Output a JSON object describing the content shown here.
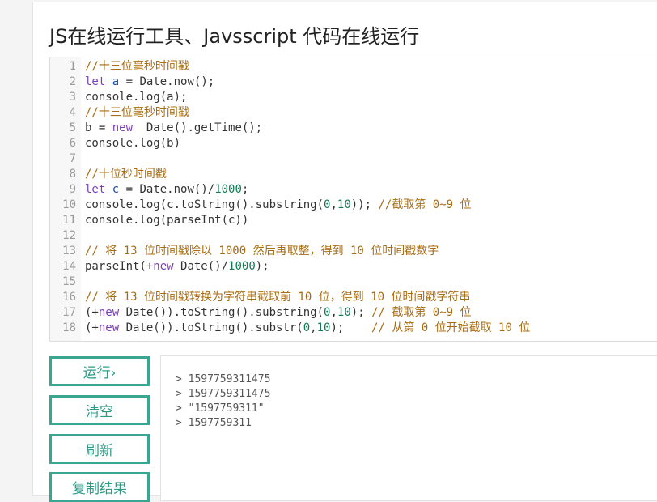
{
  "page": {
    "title": "JS在线运行工具、Javsscript 代码在线运行"
  },
  "editor": {
    "lines": [
      {
        "no": "1",
        "tokens": [
          {
            "t": "comment",
            "v": "//十三位毫秒时间戳"
          }
        ]
      },
      {
        "no": "2",
        "tokens": [
          {
            "t": "kw",
            "v": "let"
          },
          {
            "t": "plain",
            "v": " "
          },
          {
            "t": "var",
            "v": "a"
          },
          {
            "t": "plain",
            "v": " = Date.now();"
          }
        ]
      },
      {
        "no": "3",
        "tokens": [
          {
            "t": "plain",
            "v": "console.log(a);"
          }
        ]
      },
      {
        "no": "4",
        "tokens": [
          {
            "t": "comment",
            "v": "//十三位毫秒时间戳"
          }
        ]
      },
      {
        "no": "5",
        "tokens": [
          {
            "t": "plain",
            "v": "b = "
          },
          {
            "t": "kw",
            "v": "new"
          },
          {
            "t": "plain",
            "v": "  Date().getTime();"
          }
        ]
      },
      {
        "no": "6",
        "tokens": [
          {
            "t": "plain",
            "v": "console.log(b)"
          }
        ]
      },
      {
        "no": "7",
        "tokens": []
      },
      {
        "no": "8",
        "tokens": [
          {
            "t": "comment",
            "v": "//十位秒时间戳"
          }
        ]
      },
      {
        "no": "9",
        "tokens": [
          {
            "t": "kw",
            "v": "let"
          },
          {
            "t": "plain",
            "v": " "
          },
          {
            "t": "var",
            "v": "c"
          },
          {
            "t": "plain",
            "v": " = Date.now()/"
          },
          {
            "t": "num",
            "v": "1000"
          },
          {
            "t": "plain",
            "v": ";"
          }
        ]
      },
      {
        "no": "10",
        "tokens": [
          {
            "t": "plain",
            "v": "console.log(c.toString().substring("
          },
          {
            "t": "num",
            "v": "0"
          },
          {
            "t": "plain",
            "v": ","
          },
          {
            "t": "num",
            "v": "10"
          },
          {
            "t": "plain",
            "v": ")); "
          },
          {
            "t": "comment",
            "v": "//截取第 0~9 位"
          }
        ]
      },
      {
        "no": "11",
        "tokens": [
          {
            "t": "plain",
            "v": "console.log(parseInt(c))"
          }
        ]
      },
      {
        "no": "12",
        "tokens": []
      },
      {
        "no": "13",
        "tokens": [
          {
            "t": "comment",
            "v": "// 将 13 位时间戳除以 1000 然后再取整，得到 10 位时间戳数字"
          }
        ]
      },
      {
        "no": "14",
        "tokens": [
          {
            "t": "plain",
            "v": "parseInt(+"
          },
          {
            "t": "kw",
            "v": "new"
          },
          {
            "t": "plain",
            "v": " Date()/"
          },
          {
            "t": "num",
            "v": "1000"
          },
          {
            "t": "plain",
            "v": ");"
          }
        ]
      },
      {
        "no": "15",
        "tokens": []
      },
      {
        "no": "16",
        "tokens": [
          {
            "t": "comment",
            "v": "// 将 13 位时间戳转换为字符串截取前 10 位，得到 10 位时间戳字符串"
          }
        ]
      },
      {
        "no": "17",
        "tokens": [
          {
            "t": "plain",
            "v": "(+"
          },
          {
            "t": "kw",
            "v": "new"
          },
          {
            "t": "plain",
            "v": " Date()).toString().substring("
          },
          {
            "t": "num",
            "v": "0"
          },
          {
            "t": "plain",
            "v": ","
          },
          {
            "t": "num",
            "v": "10"
          },
          {
            "t": "plain",
            "v": "); "
          },
          {
            "t": "comment",
            "v": "// 截取第 0~9 位"
          }
        ]
      },
      {
        "no": "18",
        "tokens": [
          {
            "t": "plain",
            "v": "(+"
          },
          {
            "t": "kw",
            "v": "new"
          },
          {
            "t": "plain",
            "v": " Date()).toString().substr("
          },
          {
            "t": "num",
            "v": "0"
          },
          {
            "t": "plain",
            "v": ","
          },
          {
            "t": "num",
            "v": "10"
          },
          {
            "t": "plain",
            "v": ");    "
          },
          {
            "t": "comment",
            "v": "// 从第 0 位开始截取 10 位"
          }
        ]
      }
    ]
  },
  "buttons": {
    "run": "运行›",
    "clear": "清空",
    "refresh": "刷新",
    "copy": "复制结果"
  },
  "output": {
    "lines": [
      "> 1597759311475",
      "> 1597759311475",
      "> \"1597759311\"",
      "> 1597759311"
    ]
  },
  "colors": {
    "accent": "#3aa591",
    "comment": "#a86c12",
    "keyword": "#7a3fb8",
    "variable": "#1a4fa0",
    "number": "#117a53"
  }
}
